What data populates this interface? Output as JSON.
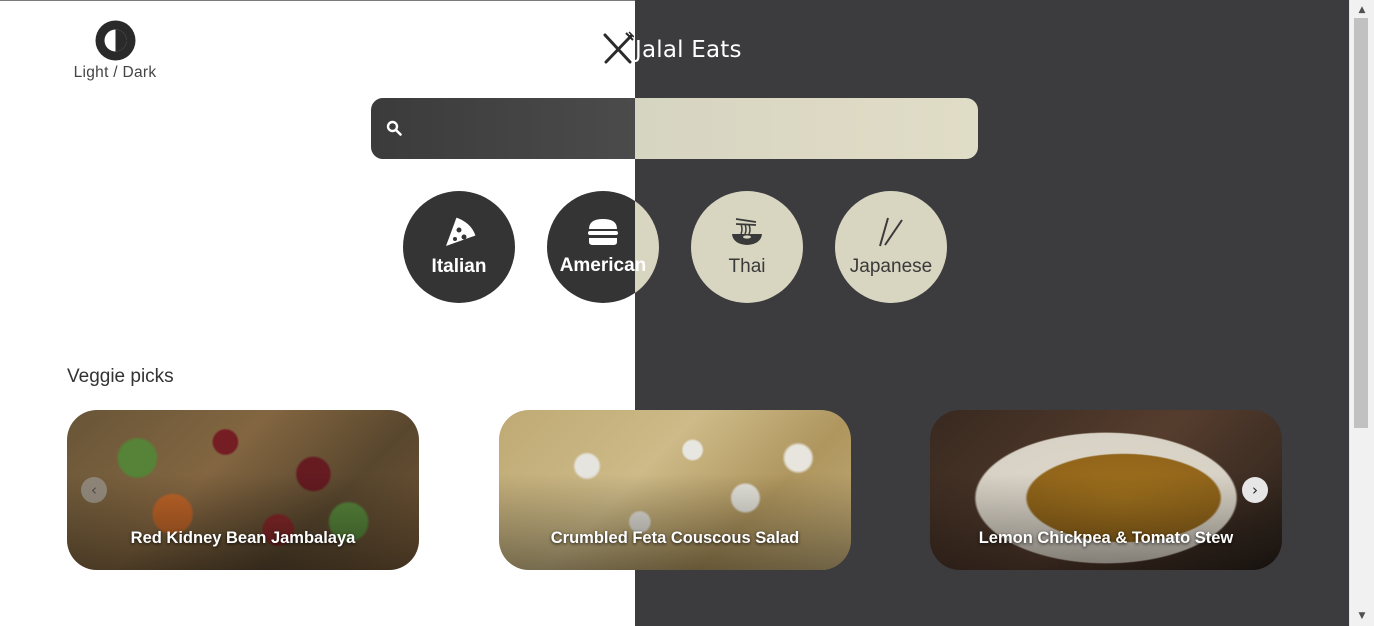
{
  "theme_toggle": {
    "label": "Light / Dark",
    "icon": "contrast-icon"
  },
  "brand": {
    "name": "Jalal Eats",
    "icon": "utensils-icon"
  },
  "search": {
    "placeholder": "",
    "value": "",
    "icon": "search-icon"
  },
  "cuisines": [
    {
      "label": "Italian",
      "icon": "pizza-icon"
    },
    {
      "label": "American",
      "icon": "burger-icon"
    },
    {
      "label": "Thai",
      "icon": "noodle-bowl-icon"
    },
    {
      "label": "Japanese",
      "icon": "chopsticks-icon"
    }
  ],
  "section": {
    "title": "Veggie picks"
  },
  "cards": [
    {
      "title": "Red Kidney Bean Jambalaya"
    },
    {
      "title": "Crumbled Feta Couscous Salad"
    },
    {
      "title": "Lemon Chickpea & Tomato Stew"
    }
  ],
  "carousel": {
    "prev": "‹",
    "next": "›"
  },
  "colors": {
    "dark_bg": "#3c3b3e",
    "light_bg": "#ffffff",
    "cream": "#d8d5c1",
    "dark_circle": "#343434"
  }
}
